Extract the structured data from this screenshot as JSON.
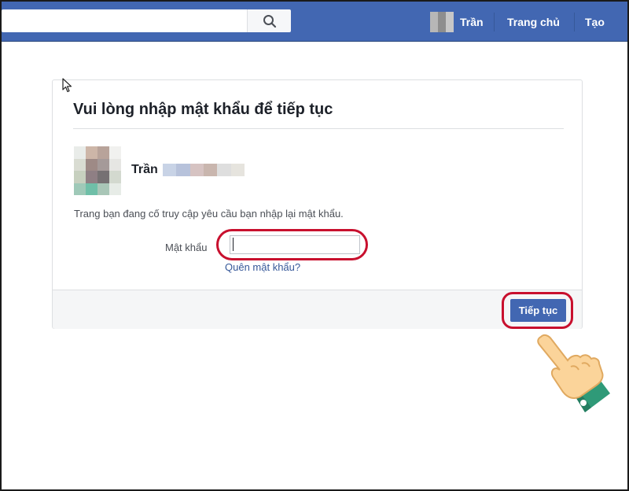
{
  "topbar": {
    "search": {
      "value": "",
      "placeholder": "",
      "icon": "search-icon"
    },
    "profile_name": "Trần",
    "home_label": "Trang chủ",
    "create_label": "Tạo",
    "color": "#4267b2"
  },
  "dialog": {
    "title": "Vui lòng nhập mật khẩu để tiếp tục",
    "user_name": "Trần",
    "message": "Trang bạn đang cố truy cập yêu cầu bạn nhập lại mật khẩu.",
    "password_label": "Mật khẩu",
    "password_value": "",
    "forgot_link": "Quên mật khẩu?",
    "continue_label": "Tiếp tục"
  },
  "annotations": {
    "highlight_color": "#c8102e",
    "pointer": "pointing-hand-icon"
  }
}
